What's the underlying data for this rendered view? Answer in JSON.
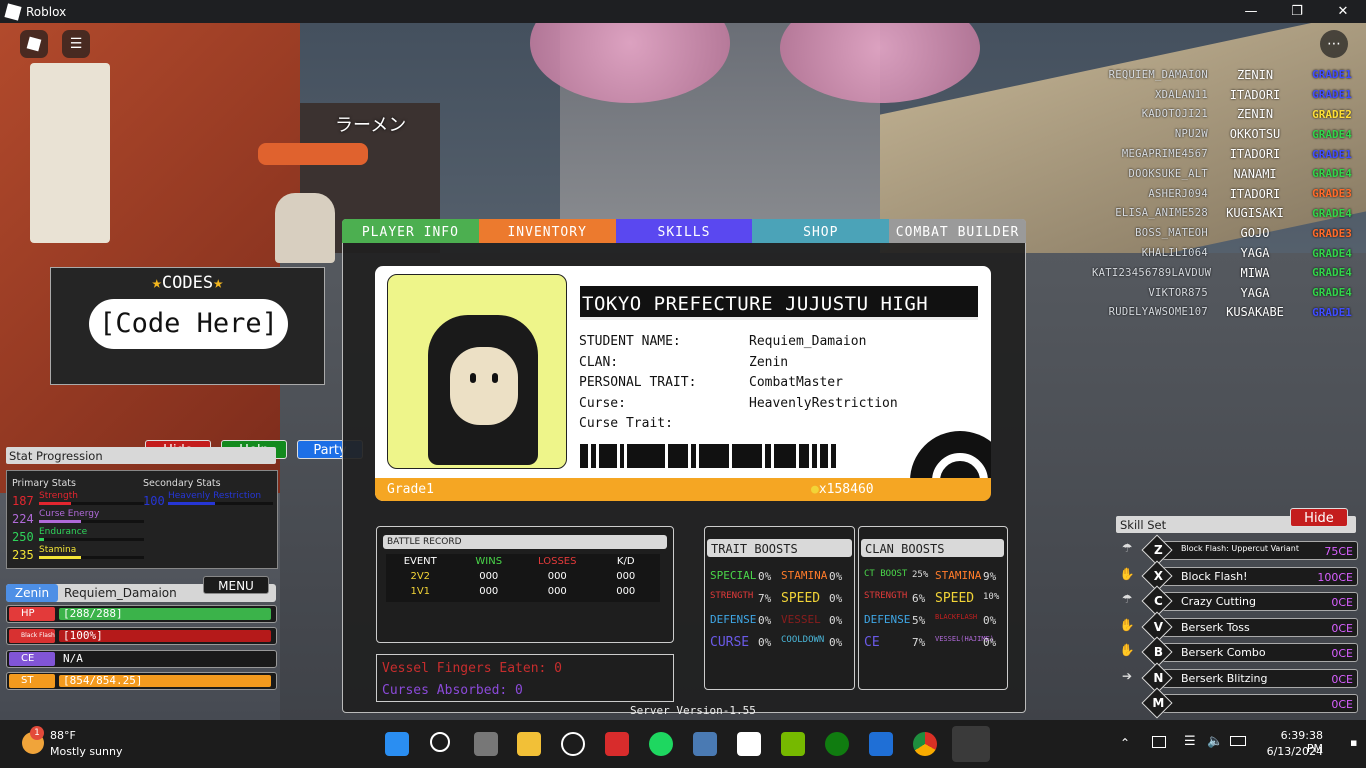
{
  "window": {
    "title": "Roblox"
  },
  "leaderboard": [
    {
      "player": "REQUIEM_DAMAION",
      "clan": "ZENIN",
      "grade": "GRADE1",
      "color": "#3f4cff"
    },
    {
      "player": "XDALAN11",
      "clan": "ITADORI",
      "grade": "GRADE1",
      "color": "#3f4cff"
    },
    {
      "player": "KADOTOJI21",
      "clan": "ZENIN",
      "grade": "GRADE2",
      "color": "#ffe032"
    },
    {
      "player": "NPU2W",
      "clan": "OKKOTSU",
      "grade": "GRADE4",
      "color": "#32d44a"
    },
    {
      "player": "MEGAPRIME4567",
      "clan": "ITADORI",
      "grade": "GRADE1",
      "color": "#3f4cff"
    },
    {
      "player": "DOOKSUKE_ALT",
      "clan": "NANAMI",
      "grade": "GRADE4",
      "color": "#32d44a"
    },
    {
      "player": "ASHERJ094",
      "clan": "ITADORI",
      "grade": "GRADE3",
      "color": "#ff6a2a"
    },
    {
      "player": "ELISA_ANIME528",
      "clan": "KUGISAKI",
      "grade": "GRADE4",
      "color": "#32d44a"
    },
    {
      "player": "BOSS_MATEOH",
      "clan": "GOJO",
      "grade": "GRADE3",
      "color": "#ff6a2a"
    },
    {
      "player": "KHALILI064",
      "clan": "YAGA",
      "grade": "GRADE4",
      "color": "#32d44a"
    },
    {
      "player": "KATI23456789LAVDUW",
      "clan": "MIWA",
      "grade": "GRADE4",
      "color": "#32d44a"
    },
    {
      "player": "VIKTOR875",
      "clan": "YAGA",
      "grade": "GRADE4",
      "color": "#32d44a"
    },
    {
      "player": "RUDELYAWSOME107",
      "clan": "KUSAKABE",
      "grade": "GRADE1",
      "color": "#3f4cff"
    }
  ],
  "codes": {
    "title": "CODES",
    "placeholder": "[Code Here]"
  },
  "buttons": {
    "hide": "Hide",
    "help": "Help",
    "party": "Party",
    "menu": "MENU",
    "skill_hide": "Hide"
  },
  "stat_progression": {
    "title": "Stat Progression",
    "primary_header": "Primary Stats",
    "secondary_header": "Secondary Stats",
    "primary": [
      {
        "value": "187",
        "label": "Strength",
        "color": "#e3262f",
        "fill": 0.3
      },
      {
        "value": "224",
        "label": "Curse Energy",
        "color": "#b06ad9",
        "fill": 0.4
      },
      {
        "value": "250",
        "label": "Endurance",
        "color": "#2fd35a",
        "fill": 0.05
      },
      {
        "value": "235",
        "label": "Stamina",
        "color": "#f2e437",
        "fill": 0.4
      }
    ],
    "secondary": [
      {
        "value": "100",
        "label": "Heavenly Restriction",
        "color": "#2636d6",
        "fill": 0.45
      }
    ]
  },
  "character": {
    "clan": "Zenin",
    "name": "Requiem_Damaion"
  },
  "meters": [
    {
      "tag": "HP",
      "text": "[288/288]",
      "color": "#e33a3a",
      "fill_color": "#3bb34a",
      "fill": 1.0
    },
    {
      "tag": "Black Flash",
      "text": "[100%]",
      "color": "#d83131",
      "fill_color": "#b51a1a",
      "fill": 1.0
    },
    {
      "tag": "CE",
      "text": "N/A",
      "color": "#8155d6",
      "fill_color": "#000000",
      "fill": 0.0
    },
    {
      "tag": "ST",
      "text": "[854/854.25]",
      "color": "#f39a1e",
      "fill_color": "#f39a1e",
      "fill": 1.0
    }
  ],
  "tabs": [
    {
      "label": "PLAYER INFO",
      "color": "#4caf50"
    },
    {
      "label": "INVENTORY",
      "color": "#ec7a2e"
    },
    {
      "label": "SKILLS",
      "color": "#5a48f0"
    },
    {
      "label": "SHOP",
      "color": "#4ba3b8"
    },
    {
      "label": "COMBAT BUILDER",
      "color": "#9a9a9a"
    }
  ],
  "id_card": {
    "school": "TOKYO PREFECTURE JUJUSTU HIGH",
    "fields": [
      {
        "label": "STUDENT NAME:",
        "value": "Requiem_Damaion"
      },
      {
        "label": "CLAN:",
        "value": "Zenin"
      },
      {
        "label": "PERSONAL TRAIT:",
        "value": "CombatMaster"
      },
      {
        "label": "Curse:",
        "value": "HeavenlyRestriction"
      },
      {
        "label": "Curse Trait:",
        "value": ""
      }
    ],
    "grade": "Grade1",
    "coins": "x158460"
  },
  "battle_record": {
    "title": "BATTLE RECORD",
    "columns": [
      "EVENT",
      "WINS",
      "LOSSES",
      "K/D"
    ],
    "rows": [
      [
        "2V2",
        "000",
        "000",
        "000"
      ],
      [
        "1V1",
        "000",
        "000",
        "000"
      ]
    ]
  },
  "counters": {
    "vessel": "Vessel Fingers Eaten: 0",
    "curses": "Curses Absorbed: 0"
  },
  "server_version": "Server Version-1.55",
  "trait_boosts": {
    "title": "TRAIT BOOSTS",
    "items": [
      {
        "name": "SPECIAL",
        "value": "0%",
        "color": "#4ad64a"
      },
      {
        "name": "STAMINA",
        "value": "0%",
        "color": "#ff7b2a"
      },
      {
        "name": "STRENGTH",
        "value": "7%",
        "color": "#e33a3a"
      },
      {
        "name": "SPEED",
        "value": "0%",
        "color": "#f2d437"
      },
      {
        "name": "DEFENSE",
        "value": "0%",
        "color": "#3fa7e6"
      },
      {
        "name": "VESSEL",
        "value": "0%",
        "color": "#8a1d1d"
      },
      {
        "name": "CURSE",
        "value": "0%",
        "color": "#6b5ae8"
      },
      {
        "name": "COOLDOWN",
        "value": "0%",
        "color": "#4ab6d8"
      }
    ]
  },
  "clan_boosts": {
    "title": "CLAN BOOSTS",
    "items": [
      {
        "name": "CT BOOST",
        "value": "25%",
        "color": "#4ad64a"
      },
      {
        "name": "STAMINA",
        "value": "9%",
        "color": "#ff7b2a"
      },
      {
        "name": "STRENGTH",
        "value": "6%",
        "color": "#e33a3a"
      },
      {
        "name": "SPEED",
        "value": "10%",
        "color": "#f2d437"
      },
      {
        "name": "DEFENSE",
        "value": "5%",
        "color": "#3fa7e6"
      },
      {
        "name": "BLACKFLASH",
        "value": "0%",
        "color": "#c42020"
      },
      {
        "name": "CE",
        "value": "7%",
        "color": "#6b5ae8"
      },
      {
        "name": "VESSEL(HAJIME)",
        "value": "0%",
        "color": "#b06ad9"
      }
    ]
  },
  "skill_set": {
    "title": "Skill Set",
    "skills": [
      {
        "key": "Z",
        "name": "Block Flash: Uppercut Variant",
        "ce": "75CE"
      },
      {
        "key": "X",
        "name": "Block Flash!",
        "ce": "100CE"
      },
      {
        "key": "C",
        "name": "Crazy Cutting",
        "ce": "0CE"
      },
      {
        "key": "V",
        "name": "Berserk Toss",
        "ce": "0CE"
      },
      {
        "key": "B",
        "name": "Berserk Combo",
        "ce": "0CE"
      },
      {
        "key": "N",
        "name": "Berserk Blitzing",
        "ce": "0CE"
      },
      {
        "key": "M",
        "name": "",
        "ce": "0CE"
      }
    ]
  },
  "taskbar": {
    "weather_temp": "88°F",
    "weather_desc": "Mostly sunny",
    "weather_badge": "1",
    "time": "6:39:38 PM",
    "date": "6/13/2024"
  },
  "scene": {
    "sign_text": "ラーメン"
  }
}
